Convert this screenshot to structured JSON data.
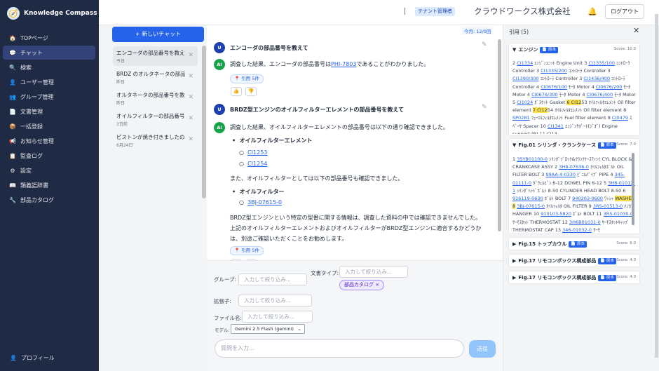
{
  "app": {
    "name": "Knowledge Compass"
  },
  "nav": {
    "items": [
      {
        "label": "TOPページ",
        "icon": "home-icon",
        "glyph": "🏠"
      },
      {
        "label": "チャット",
        "icon": "chat-icon",
        "glyph": "💬"
      },
      {
        "label": "検索",
        "icon": "search-icon",
        "glyph": "🔍"
      },
      {
        "label": "ユーザー管理",
        "icon": "user-icon",
        "glyph": "👤"
      },
      {
        "label": "グループ管理",
        "icon": "group-icon",
        "glyph": "👥"
      },
      {
        "label": "文書管理",
        "icon": "document-icon",
        "glyph": "📄"
      },
      {
        "label": "一括登録",
        "icon": "package-icon",
        "glyph": "📦"
      },
      {
        "label": "お知らせ管理",
        "icon": "megaphone-icon",
        "glyph": "📢"
      },
      {
        "label": "監査ログ",
        "icon": "log-icon",
        "glyph": "📋"
      },
      {
        "label": "設定",
        "icon": "gear-icon",
        "glyph": "⚙"
      },
      {
        "label": "類義語辞書",
        "icon": "book-icon",
        "glyph": "📖"
      },
      {
        "label": "部品カタログ",
        "icon": "wrench-icon",
        "glyph": "🔧"
      }
    ],
    "profile": "プロフィール"
  },
  "header": {
    "tenant_badge": "テナント管理者",
    "company": "クラウドワークス株式会社",
    "logout": "ログアウト"
  },
  "chat_list": {
    "new_chat": "+ 新しいチャット",
    "items": [
      {
        "title": "エンコーダの部品番号を教えて",
        "date": "今日"
      },
      {
        "title": "BRDZ のオルタネータの部品番号を...",
        "date": "昨日"
      },
      {
        "title": "オルタネータの部品番号を教...",
        "date": "昨日"
      },
      {
        "title": "オイルフィルターの部品番号を...",
        "date": "3日前"
      },
      {
        "title": "ピストンが焼き付きましたの...",
        "date": "6月24日"
      }
    ]
  },
  "conversation": {
    "usage": "今月: 12/0回",
    "q1": "エンコーダの部品番号を教えて",
    "a1_prefix": "調査した結果、エンコーダの部品番号は",
    "a1_link": "PHI-7803",
    "a1_suffix": "であることがわかりました。",
    "cite_btn": "引用 5件",
    "q2": "BRDZ型エンジンのオイルフィルターエレメントの部品番号を教えて",
    "a2_intro": "調査した結果、オイルフィルターエレメントの部品番号は以下の通り確認できました。",
    "a2_h1": "オイルフィルターエレメント",
    "a2_l1": "CI1253",
    "a2_l2": "CI1254",
    "a2_mid": "また、オイルフィルターとしては以下の部品番号も確認できました。",
    "a2_h2": "オイルフィルター",
    "a2_l3": "3BJ-07615-0",
    "a2_p1": "BRDZ型エンジンという特定の型番に関する情報は、調査した資料の中では確認できませんでした。",
    "a2_p2": "上記のオイルフィルターエレメントおよびオイルフィルターがBRDZ型エンジンに適合するかどうか",
    "a2_p3": "は、別途ご確認いただくことをお勧めします。",
    "avatar_user": "U",
    "avatar_ai": "AI"
  },
  "filters": {
    "group_label": "グループ:",
    "doctype_label": "文書タイプ:",
    "ext_label": "拡張子:",
    "file_label": "ファイル名:",
    "placeholder": "入力して絞り込み...",
    "tag": "部品カタログ",
    "tag_x": "×",
    "model_label": "モデル:",
    "model_value": "Gemini 2.5 Flash (gemini)",
    "question_placeholder": "質問を入力...",
    "send": "送信"
  },
  "citations": {
    "title": "引用 (5)",
    "doc_badge": "📄 原本",
    "cards": [
      {
        "title": "エンジン",
        "score": "Score: 10.0"
      },
      {
        "title": "Fig.01 シリンダ・クランクケース",
        "score": "Score: 7.0"
      },
      {
        "title": "Fig.15 トップカウル",
        "score": "Score: 6.0"
      },
      {
        "title": "Fig.17 リモコンボックス構成部品",
        "score": "Score: 4.0"
      },
      {
        "title": "Fig.17 リモコンボックス構成部品",
        "score": "Score: 4.0"
      }
    ]
  }
}
